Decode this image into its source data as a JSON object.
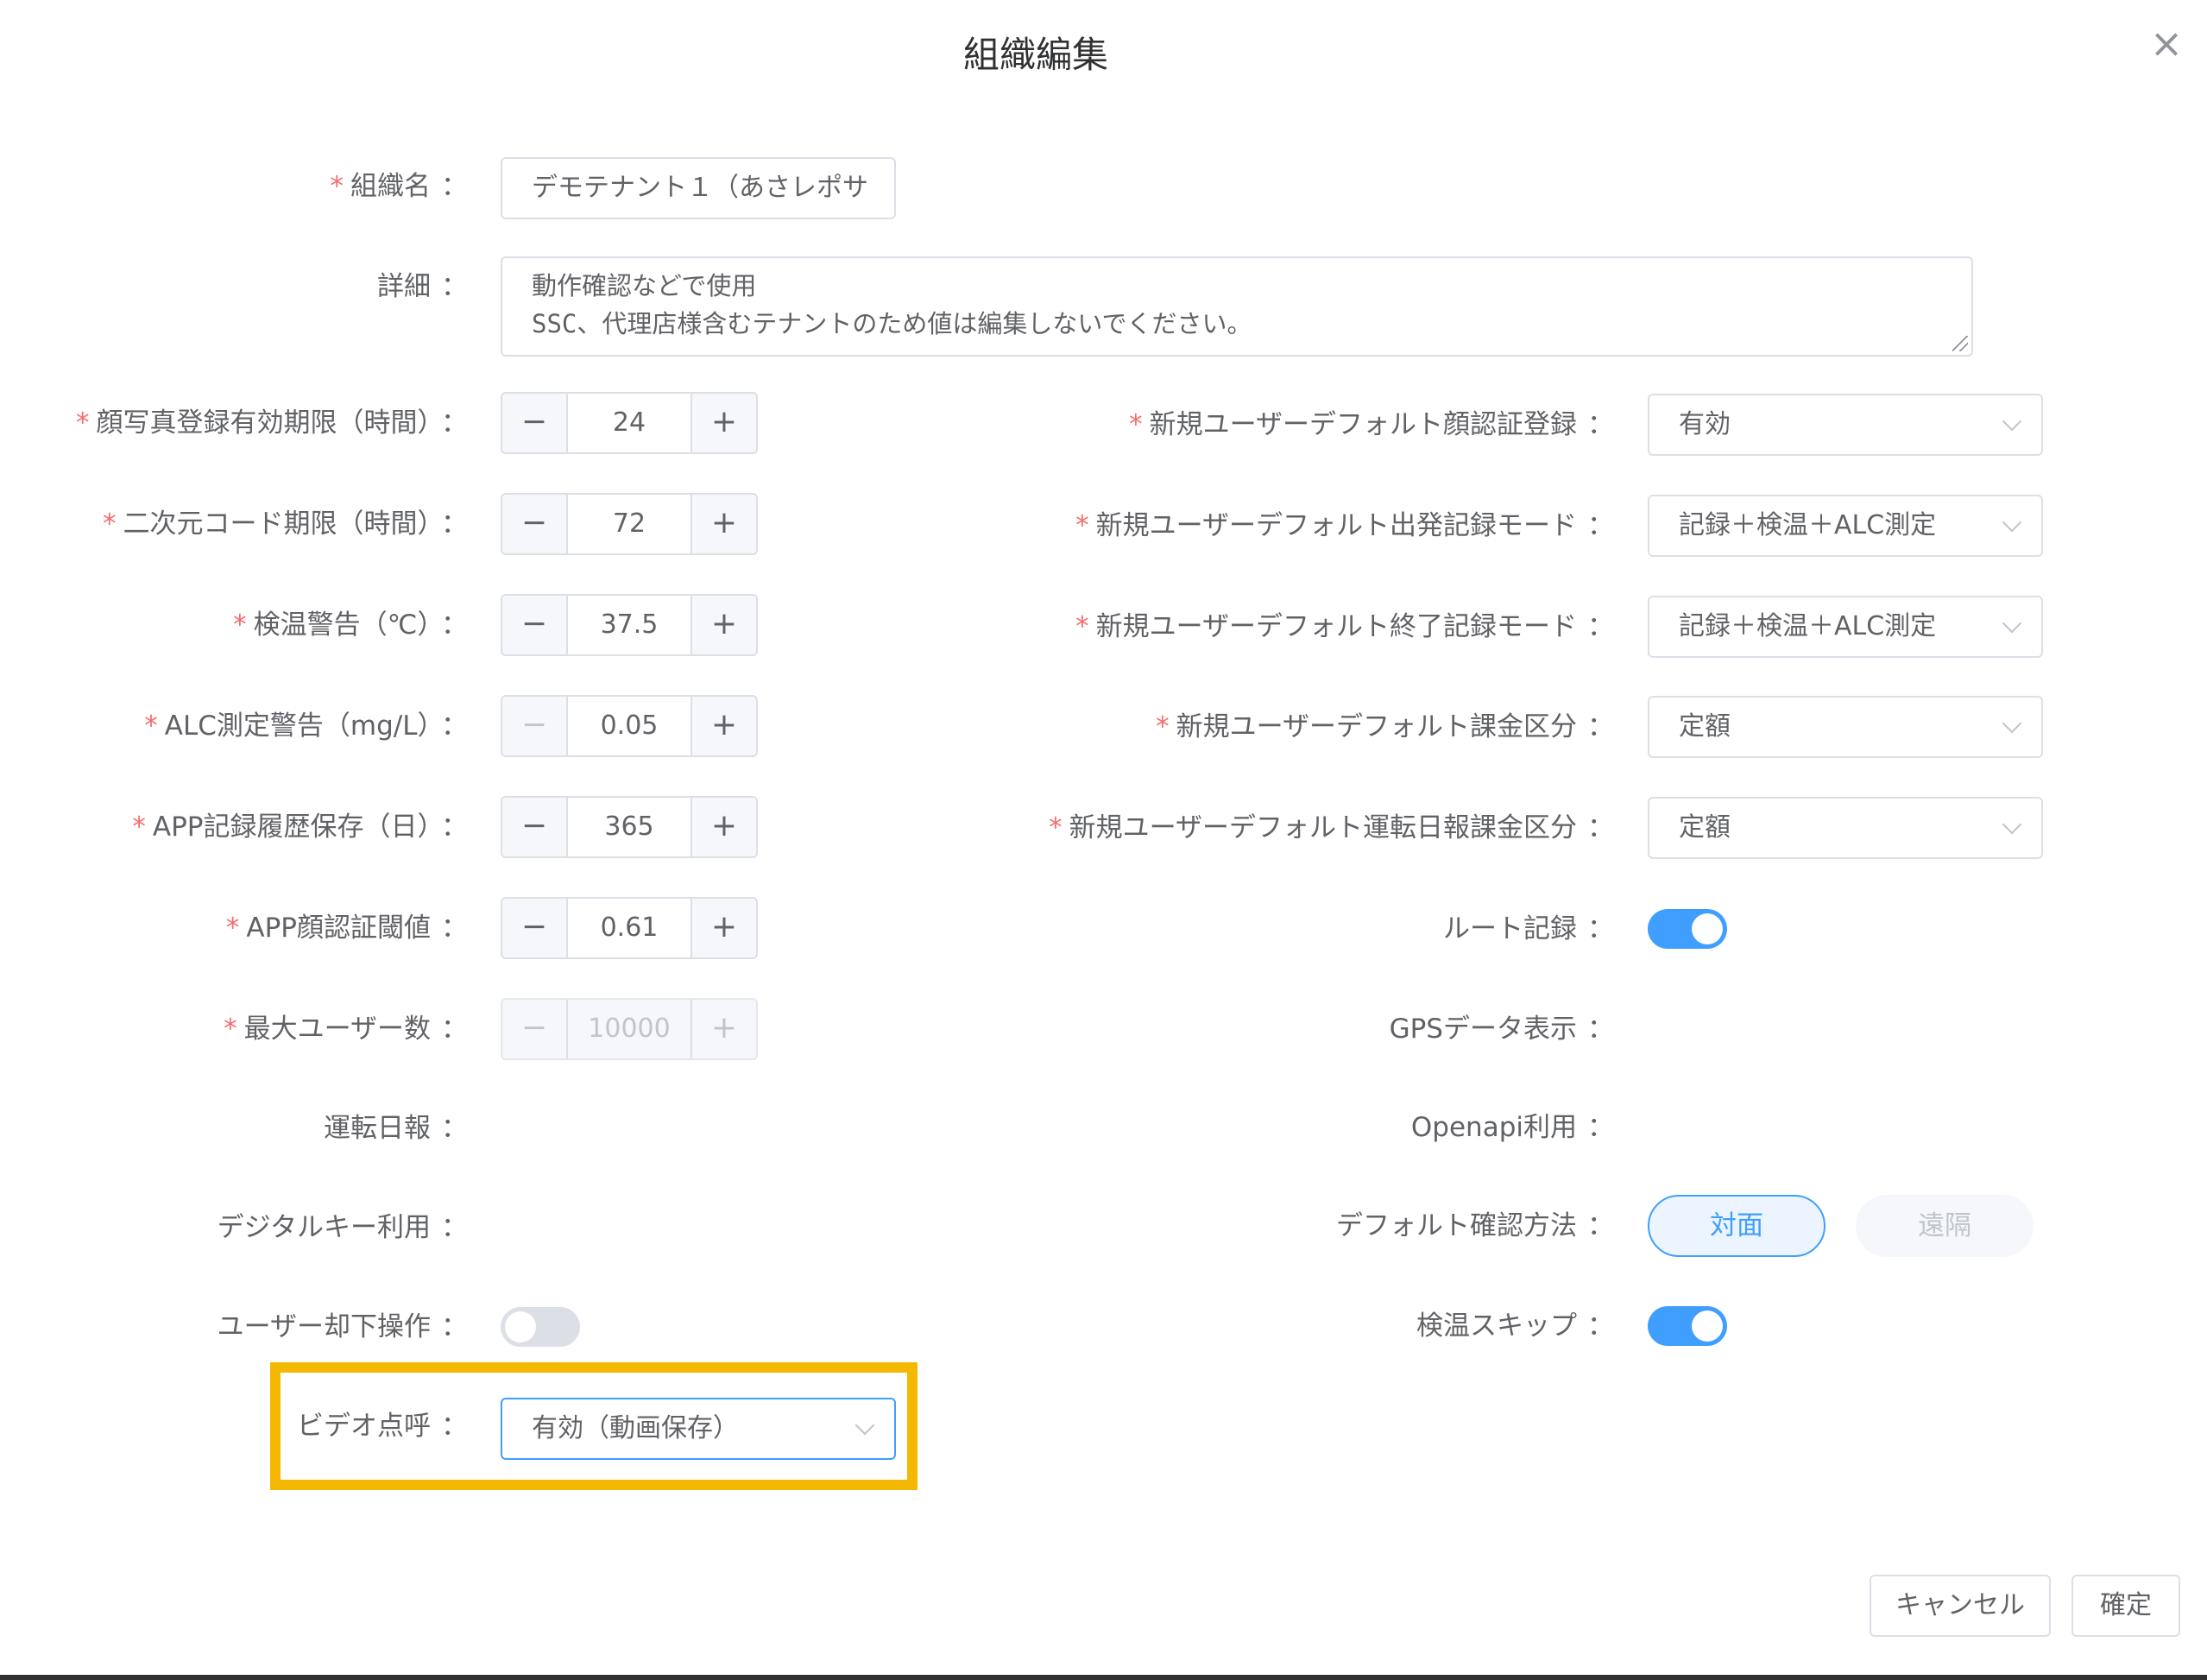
{
  "dialog": {
    "title": "組織編集",
    "close_icon": "×"
  },
  "form": {
    "org_name": {
      "label": "組織名",
      "required": true,
      "value": "デモテナント１（あさレポサ"
    },
    "detail": {
      "label": "詳細",
      "required": false,
      "line1": "動作確認などで使用",
      "line2": "SSC、代理店様含むテナントのため値は編集しないでください。"
    },
    "left_fields": [
      {
        "label": "顔写真登録有効期限（時間）",
        "required": true,
        "value": "24",
        "minus": "−",
        "plus": "+"
      },
      {
        "label": "二次元コード期限（時間）",
        "required": true,
        "value": "72",
        "minus": "−",
        "plus": "+"
      },
      {
        "label": "検温警告（℃）",
        "required": true,
        "value": "37.5",
        "minus": "−",
        "plus": "+"
      },
      {
        "label": "ALC測定警告（mg/L）",
        "required": true,
        "value": "0.05",
        "minus": "−",
        "plus": "+"
      },
      {
        "label": "APP記録履歴保存（日）",
        "required": true,
        "value": "365",
        "minus": "−",
        "plus": "+"
      },
      {
        "label": "APP顔認証閾値",
        "required": true,
        "value": "0.61",
        "minus": "−",
        "plus": "+"
      },
      {
        "label": "最大ユーザー数",
        "required": true,
        "value": "10000",
        "minus": "−",
        "plus": "+"
      }
    ],
    "left_switches": [
      {
        "label": "運転日報",
        "state": "on-disabled"
      },
      {
        "label": "デジタルキー利用",
        "state": "on-disabled"
      },
      {
        "label": "ユーザー却下操作",
        "state": "off"
      }
    ],
    "video_rollcall": {
      "label": "ビデオ点呼",
      "value": "有効（動画保存）"
    },
    "right_selects": [
      {
        "label": "新規ユーザーデフォルト顔認証登録",
        "required": true,
        "value": "有効"
      },
      {
        "label": "新規ユーザーデフォルト出発記録モード",
        "required": true,
        "value": "記録＋検温＋ALC測定"
      },
      {
        "label": "新規ユーザーデフォルト終了記録モード",
        "required": true,
        "value": "記録＋検温＋ALC測定"
      },
      {
        "label": "新規ユーザーデフォルト課金区分",
        "required": true,
        "value": "定額"
      },
      {
        "label": "新規ユーザーデフォルト運転日報課金区分",
        "required": true,
        "value": "定額"
      }
    ],
    "right_switches": [
      {
        "label": "ルート記録",
        "state": "on"
      },
      {
        "label": "GPSデータ表示",
        "state": "on-disabled"
      },
      {
        "label": "Openapi利用",
        "state": "on-disabled"
      }
    ],
    "confirm_method": {
      "label": "デフォルト確認方法",
      "option_selected": "対面",
      "option_other": "遠隔"
    },
    "temp_skip": {
      "label": "検温スキップ",
      "state": "on"
    },
    "colon": "："
  },
  "footer": {
    "cancel_label": "キャンセル",
    "ok_label": "確定"
  },
  "colors": {
    "primary": "#409eff",
    "required": "#f56c6c",
    "highlight": "#f5b800"
  }
}
